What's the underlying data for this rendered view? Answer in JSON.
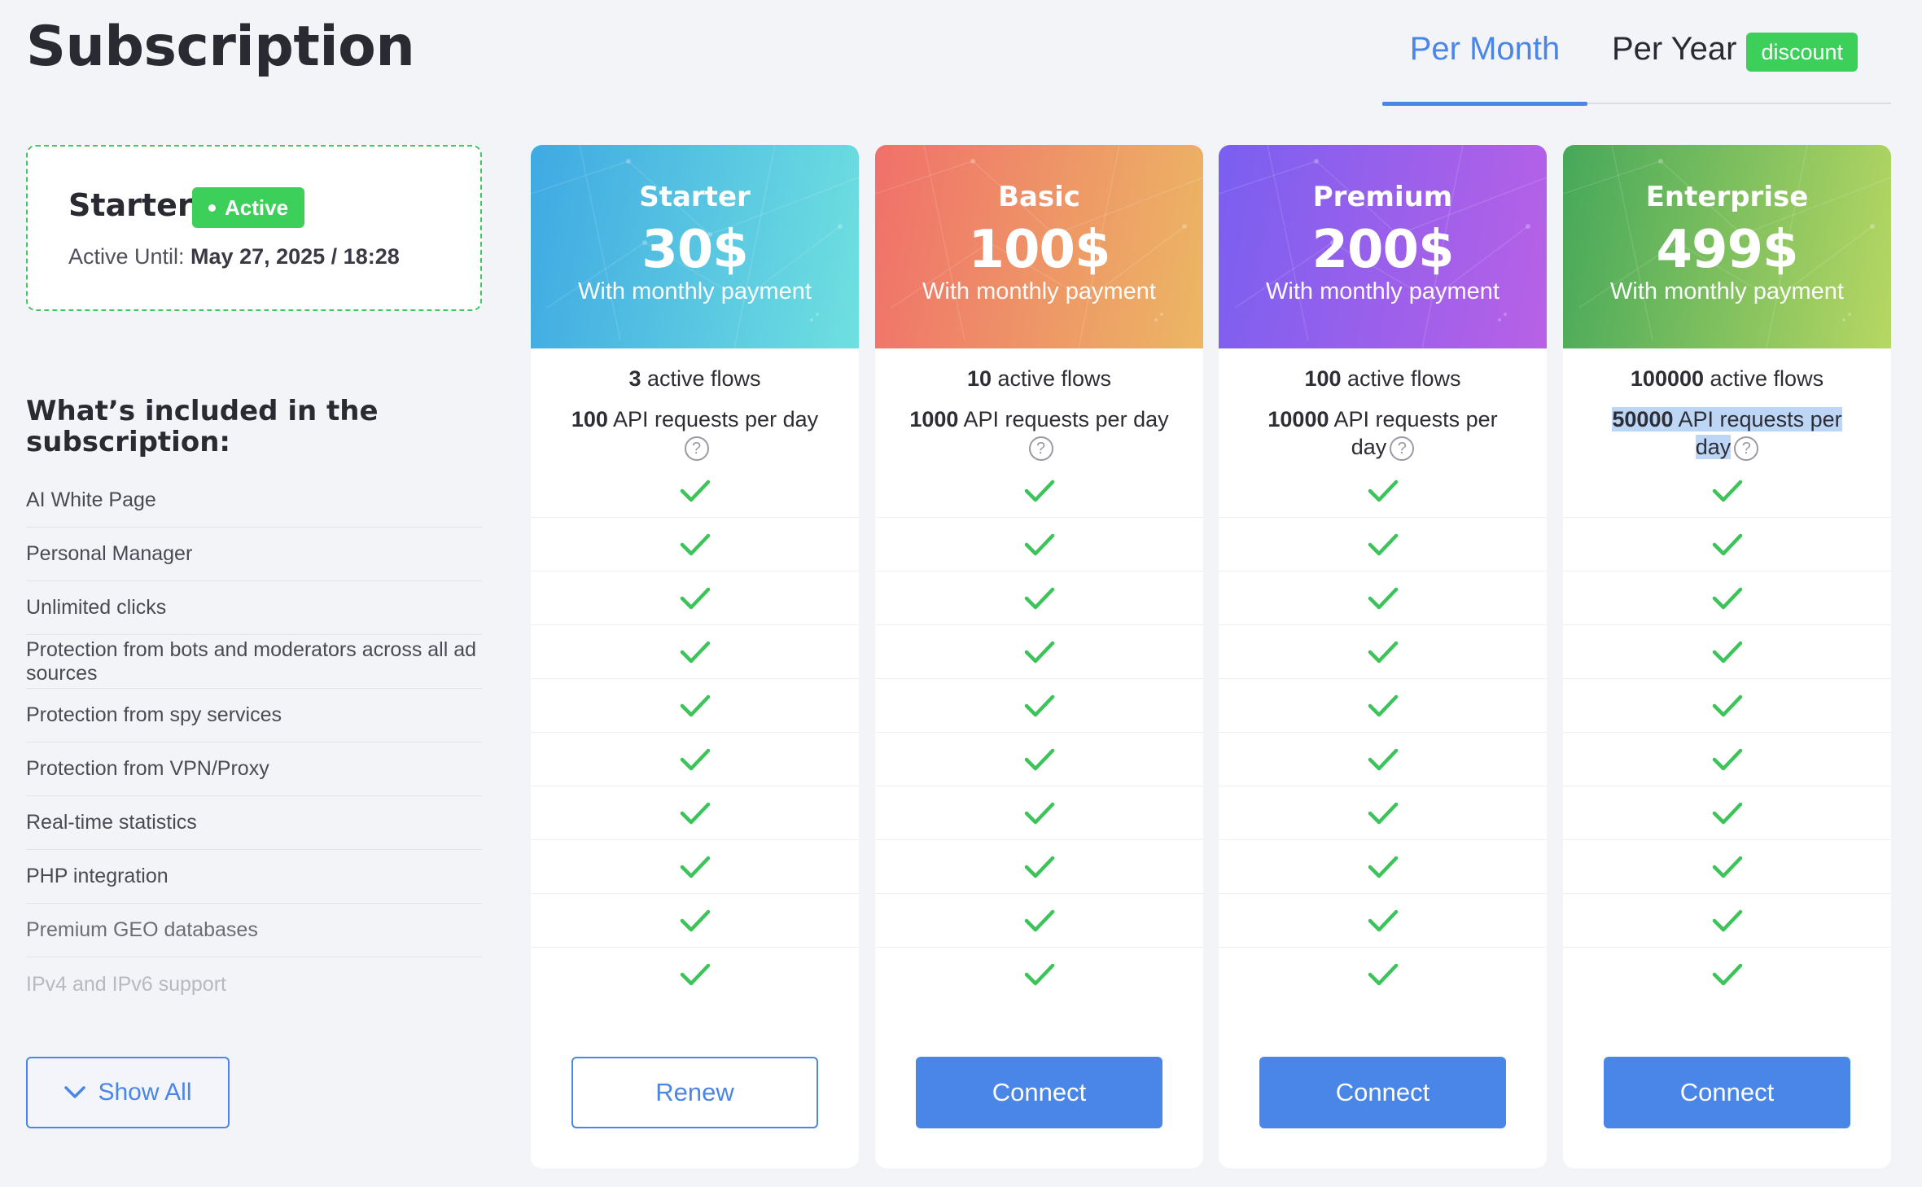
{
  "page": {
    "title": "Subscription"
  },
  "billing": {
    "per_month": "Per Month",
    "per_year": "Per Year",
    "discount": "discount",
    "selected": "Per Month"
  },
  "current": {
    "plan": "Starter",
    "status": "Active",
    "until_label": "Active Until: ",
    "until_value": "May 27, 2025 / 18:28"
  },
  "features": {
    "title": "What’s included in the subscription:",
    "items": [
      "AI White Page",
      "Personal Manager",
      "Unlimited clicks",
      "Protection from bots and moderators across all ad sources",
      "Protection from spy services",
      "Protection from VPN/Proxy",
      "Real-time statistics",
      "PHP integration",
      "Premium GEO databases",
      "IPv4 and IPv6 support"
    ],
    "show_all": "Show All"
  },
  "plans": [
    {
      "name": "Starter",
      "price": "30$",
      "period": "With monthly payment",
      "flows_num": "3",
      "flows_text": " active flows",
      "api_num": "100",
      "api_text": " API requests per day",
      "button": "Renew",
      "gradient": [
        "#3fa9e3",
        "#6fe0e0"
      ]
    },
    {
      "name": "Basic",
      "price": "100$",
      "period": "With monthly payment",
      "flows_num": "10",
      "flows_text": " active flows",
      "api_num": "1000",
      "api_text": " API requests per day",
      "button": "Connect",
      "gradient": [
        "#f0706a",
        "#ecb764"
      ]
    },
    {
      "name": "Premium",
      "price": "200$",
      "period": "With monthly payment",
      "flows_num": "100",
      "flows_text": " active flows",
      "api_num": "10000",
      "api_text": " API requests per",
      "api_text2": "day",
      "button": "Connect",
      "gradient": [
        "#7a5ff0",
        "#b861e6"
      ]
    },
    {
      "name": "Enterprise",
      "price": "499$",
      "period": "With monthly payment",
      "flows_num": "100000",
      "flows_text": " active flows",
      "api_num": "50000",
      "api_text": " API requests per",
      "api_text2": "day",
      "button": "Connect",
      "gradient": [
        "#46a85a",
        "#b7d763"
      ]
    }
  ],
  "colors": {
    "accent": "#4a86e8",
    "success": "#3ccf5a",
    "check": "#3cc45a"
  }
}
